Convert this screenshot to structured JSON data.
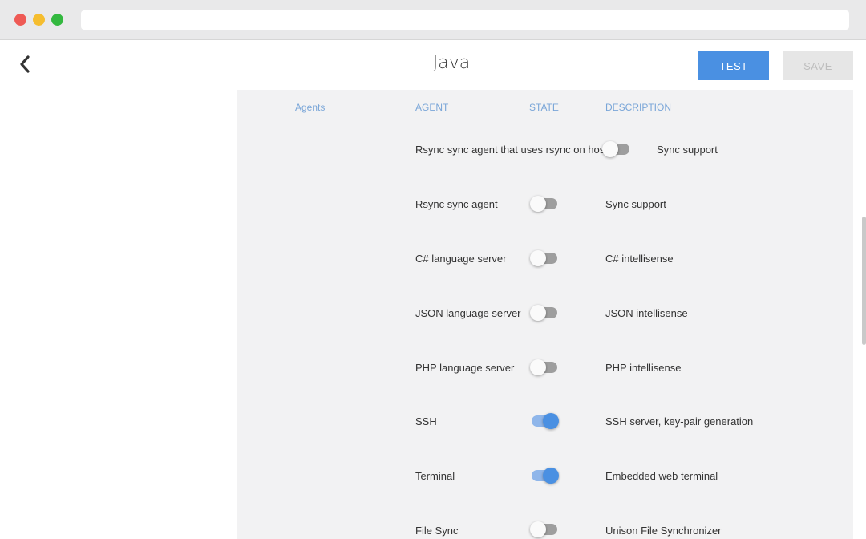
{
  "header": {
    "title": "Java",
    "test_label": "TEST",
    "save_label": "SAVE"
  },
  "table": {
    "section_label": "Agents",
    "columns": [
      "AGENT",
      "STATE",
      "DESCRIPTION"
    ],
    "rows": [
      {
        "agent": "Rsync sync agent that uses rsync on host",
        "enabled": false,
        "description": "Sync support"
      },
      {
        "agent": "Rsync sync agent",
        "enabled": false,
        "description": "Sync support"
      },
      {
        "agent": "C# language server",
        "enabled": false,
        "description": "C# intellisense"
      },
      {
        "agent": "JSON language server",
        "enabled": false,
        "description": "JSON intellisense"
      },
      {
        "agent": "PHP language server",
        "enabled": false,
        "description": "PHP intellisense"
      },
      {
        "agent": "SSH",
        "enabled": true,
        "description": "SSH server, key-pair generation"
      },
      {
        "agent": "Terminal",
        "enabled": true,
        "description": "Embedded web terminal"
      },
      {
        "agent": "File Sync",
        "enabled": false,
        "description": "Unison File Synchronizer"
      }
    ]
  },
  "colors": {
    "accent": "#4a90e2",
    "header_text": "#7aa6d8",
    "panel_bg": "#f2f2f3"
  },
  "icons": {
    "back": "chevron-left-icon"
  }
}
